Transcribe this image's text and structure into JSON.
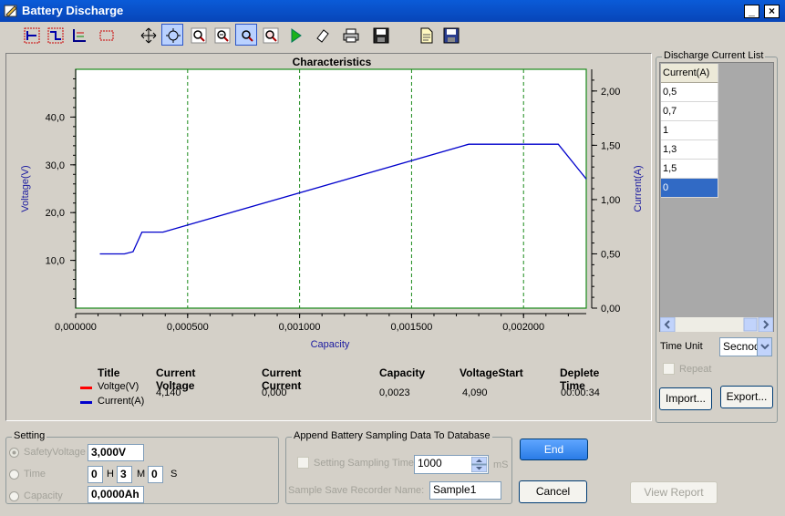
{
  "window": {
    "title": "Battery Discharge"
  },
  "toolbar": {
    "buttons": [
      {
        "name": "cursor-crosshair-red-icon"
      },
      {
        "name": "cursor-step-icon"
      },
      {
        "name": "cursor-line-icon"
      },
      {
        "name": "select-rect-icon"
      },
      {
        "name": "pan-icon"
      },
      {
        "name": "zoom-fit-icon",
        "pressed": true
      },
      {
        "name": "zoom-in-icon"
      },
      {
        "name": "zoom-out-icon"
      },
      {
        "name": "zoom-box-icon",
        "pressed": true
      },
      {
        "name": "zoom-reset-icon"
      },
      {
        "name": "run-icon"
      },
      {
        "name": "eraser-icon"
      },
      {
        "name": "print-icon"
      },
      {
        "name": "save-icon"
      },
      {
        "name": "open-file-icon"
      },
      {
        "name": "save-as-icon"
      }
    ]
  },
  "chart_data": {
    "type": "line",
    "title": "Characteristics",
    "xlabel": "Capacity",
    "ylabel": "Voltage(V)",
    "y2label": "Current(A)",
    "xlim": [
      0.0,
      0.00228
    ],
    "ylim": [
      0,
      50
    ],
    "y2lim": [
      0,
      2.2
    ],
    "xticks": [
      "0,000000",
      "0,000500",
      "0,001000",
      "0,001500",
      "0,002000"
    ],
    "yticks": [
      "10,0",
      "20,0",
      "30,0",
      "40,0"
    ],
    "y2ticks": [
      "0,00",
      "0,50",
      "1,00",
      "1,50",
      "2,00"
    ],
    "grid": "vertical dashed",
    "series": [
      {
        "name": "Current(A)",
        "axis": "right",
        "color": "#0000cc",
        "x": [
          0.000108,
          0.000218,
          0.000256,
          0.000296,
          0.00039,
          0.001755,
          0.002155,
          0.00228
        ],
        "y": [
          0.5,
          0.5,
          0.52,
          0.7,
          0.7,
          1.51,
          1.51,
          1.19
        ]
      },
      {
        "name": "Voltge(V)",
        "axis": "left",
        "color": "#ff0000",
        "x": [],
        "y": []
      }
    ]
  },
  "legend": {
    "headers": {
      "title": "Title",
      "voltage": "Current Voltage",
      "current": "Current Current",
      "capacity": "Capacity",
      "vstart": "VoltageStart",
      "deplete": "Deplete Time"
    },
    "series_voltage": "Voltge(V)",
    "series_current": "Current(A)",
    "values": {
      "voltage": "4,140",
      "current": "0,000",
      "capacity": "0,0023",
      "vstart": "4,090",
      "deplete": "00:00:34"
    },
    "colors": {
      "voltage": "#ff0000",
      "current": "#0000cc"
    }
  },
  "discharge_list": {
    "title": "Discharge Current List",
    "header": "Current(A)",
    "rows": [
      "0,5",
      "0,7",
      "1",
      "1,3",
      "1,5",
      "0"
    ],
    "selected_index": 5,
    "time_unit_label": "Time Unit",
    "time_unit_value": "Secnod",
    "repeat_label": "Repeat",
    "import_label": "Import...",
    "export_label": "Export..."
  },
  "setting": {
    "title": "Setting",
    "safety_voltage_label": "SafetyVoltage",
    "safety_voltage_value": "3,000V",
    "time_label": "Time",
    "time_h": "0",
    "time_h_unit": "H",
    "time_m": "3",
    "time_m_unit": "M",
    "time_s": "0",
    "time_s_unit": "S",
    "capacity_label": "Capacity",
    "capacity_value": "0,0000Ah"
  },
  "database": {
    "title": "Append Battery Sampling Data To Database",
    "sampling_label": "Setting Sampling Time",
    "sampling_value": "1000",
    "sampling_unit": "mS",
    "recorder_label": "Sample Save Recorder Name:",
    "recorder_value": "Sample1"
  },
  "actions": {
    "end_label": "End",
    "cancel_label": "Cancel",
    "view_report_label": "View Report"
  }
}
